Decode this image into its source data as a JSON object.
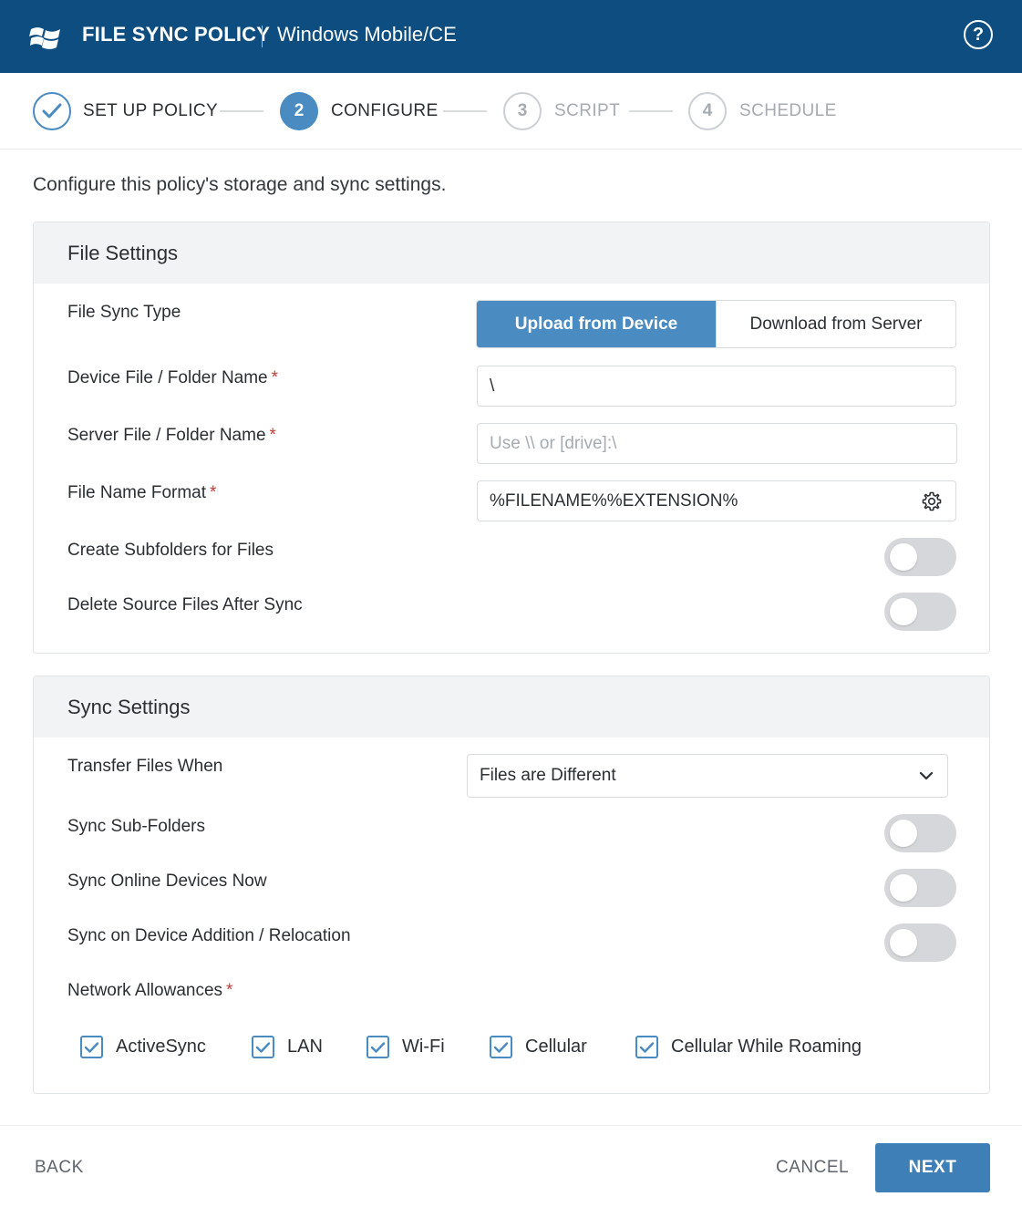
{
  "header": {
    "title": "FILE SYNC POLICY",
    "subtitle": "Windows Mobile/CE",
    "logo_icon": "windows-logo-icon",
    "help_icon": "help-icon",
    "help_glyph": "?"
  },
  "stepper": {
    "steps": [
      {
        "number": "",
        "label": "SET UP POLICY",
        "status": "completed"
      },
      {
        "number": "2",
        "label": "CONFIGURE",
        "status": "active"
      },
      {
        "number": "3",
        "label": "SCRIPT",
        "status": "upcoming"
      },
      {
        "number": "4",
        "label": "SCHEDULE",
        "status": "upcoming"
      }
    ]
  },
  "intro": "Configure this policy's storage and sync settings.",
  "file_settings": {
    "title": "File Settings",
    "sync_type": {
      "label": "File Sync Type",
      "options": [
        "Upload from Device",
        "Download from Server"
      ],
      "selected": "Upload from Device"
    },
    "device_name": {
      "label": "Device File / Folder Name",
      "required": "*",
      "value": "\\"
    },
    "server_name": {
      "label": "Server File / Folder Name",
      "required": "*",
      "value": "",
      "placeholder": "Use \\\\ or [drive]:\\"
    },
    "name_format": {
      "label": "File Name Format",
      "required": "*",
      "value": "%FILENAME%%EXTENSION%"
    },
    "create_subfolders": {
      "label": "Create Subfolders for Files",
      "on": false
    },
    "delete_source": {
      "label": "Delete Source Files After Sync",
      "on": false
    }
  },
  "sync_settings": {
    "title": "Sync Settings",
    "transfer_when": {
      "label": "Transfer Files When",
      "value": "Files are Different"
    },
    "sync_subfolders": {
      "label": "Sync Sub-Folders",
      "on": false
    },
    "sync_online_now": {
      "label": "Sync Online Devices Now",
      "on": false
    },
    "sync_on_addition": {
      "label": "Sync on Device Addition / Relocation",
      "on": false
    },
    "network": {
      "label": "Network Allowances",
      "required": "*",
      "options": [
        {
          "label": "ActiveSync",
          "checked": true
        },
        {
          "label": "LAN",
          "checked": true
        },
        {
          "label": "Wi-Fi",
          "checked": true
        },
        {
          "label": "Cellular",
          "checked": true
        },
        {
          "label": "Cellular While Roaming",
          "checked": true
        }
      ]
    }
  },
  "footer": {
    "back": "BACK",
    "cancel": "CANCEL",
    "next": "NEXT"
  },
  "colors": {
    "header_bg": "#0d4d80",
    "accent": "#4a8bc2",
    "next_bg": "#3f7fb8",
    "required": "#c43c3c"
  }
}
